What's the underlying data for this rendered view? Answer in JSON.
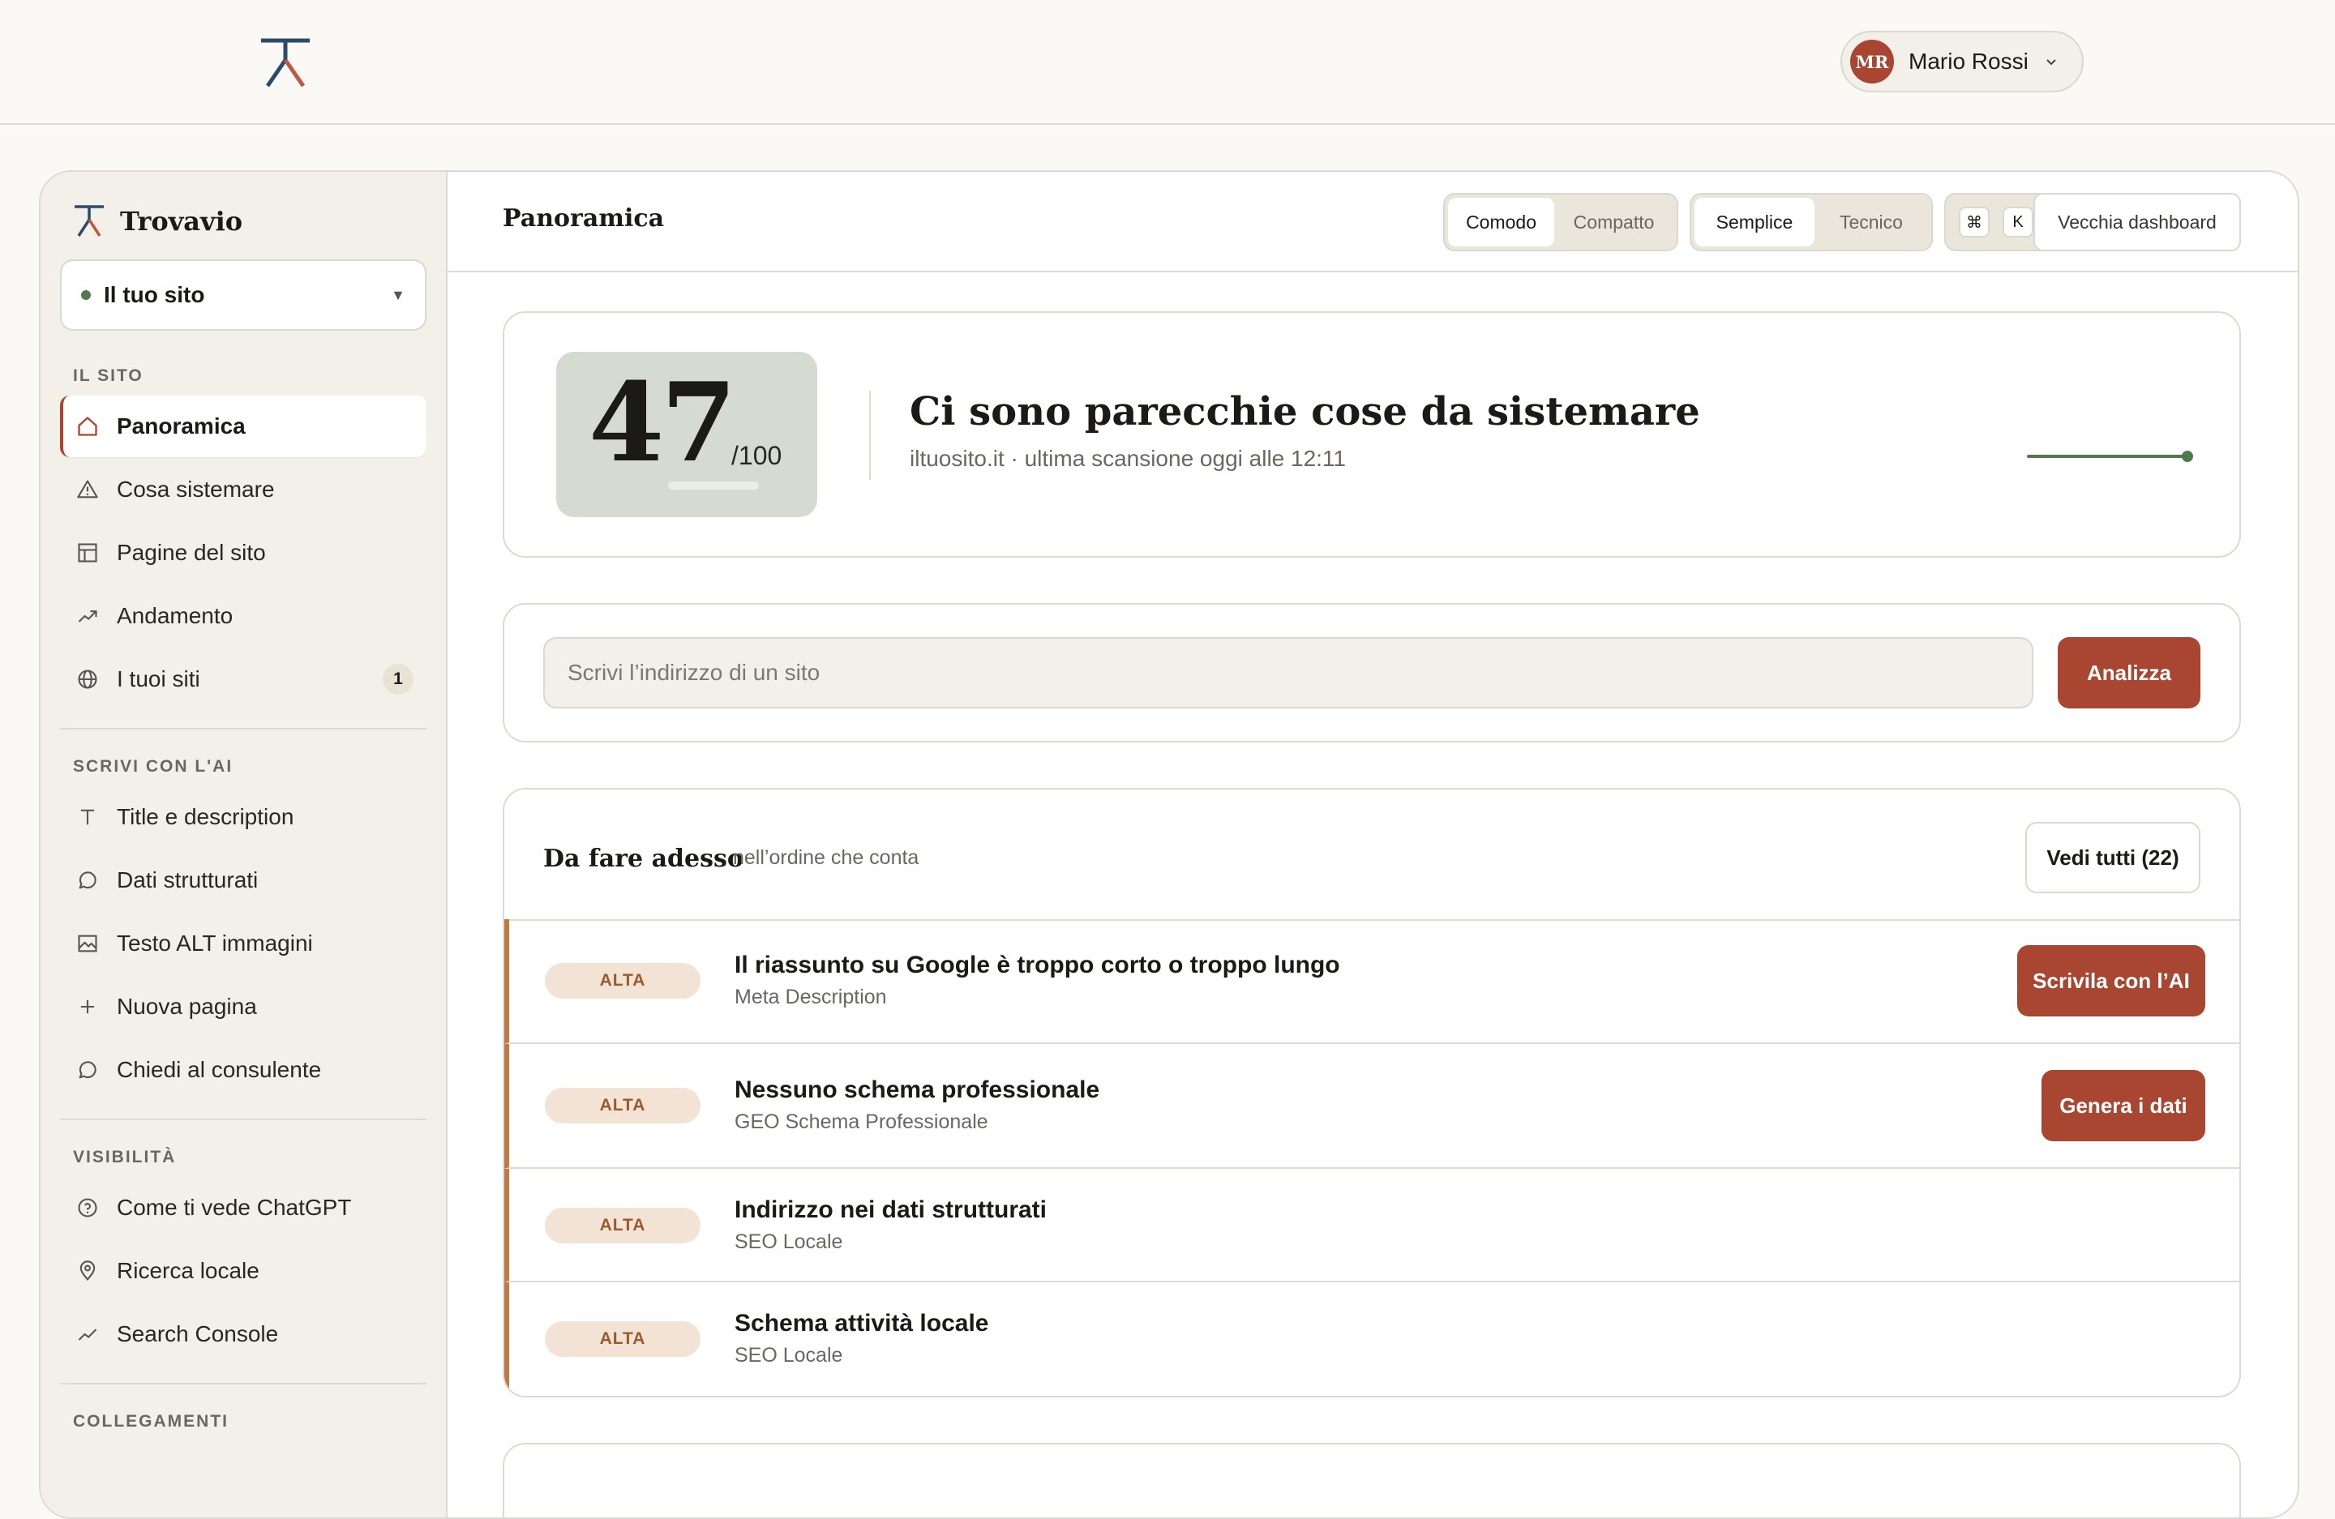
{
  "topbar": {
    "user": {
      "initials": "MR",
      "name": "Mario Rossi"
    }
  },
  "sidebar": {
    "brand": "Trovavio",
    "site_select": {
      "label": "Il tuo sito"
    },
    "sections": {
      "site": "IL SITO",
      "ai": "SCRIVI CON L'AI",
      "visibility": "VISIBILITÀ",
      "links": "COLLEGAMENTI"
    },
    "site_items": [
      {
        "label": "Panoramica",
        "icon": "home-icon",
        "active": true
      },
      {
        "label": "Cosa sistemare",
        "icon": "warning-icon"
      },
      {
        "label": "Pagine del sito",
        "icon": "layout-icon"
      },
      {
        "label": "Andamento",
        "icon": "trend-icon"
      },
      {
        "label": "I tuoi siti",
        "icon": "globe-icon",
        "badge": "1"
      }
    ],
    "ai_items": [
      {
        "label": "Title e description",
        "icon": "type-icon"
      },
      {
        "label": "Dati strutturati",
        "icon": "chat-icon"
      },
      {
        "label": "Testo ALT immagini",
        "icon": "image-icon"
      },
      {
        "label": "Nuova pagina",
        "icon": "plus-icon"
      },
      {
        "label": "Chiedi al consulente",
        "icon": "chat-icon"
      }
    ],
    "visibility_items": [
      {
        "label": "Come ti vede ChatGPT",
        "icon": "help-circle-icon"
      },
      {
        "label": "Ricerca locale",
        "icon": "map-pin-icon"
      },
      {
        "label": "Search Console",
        "icon": "trend-icon"
      }
    ]
  },
  "header": {
    "title": "Panoramica",
    "density": {
      "options": [
        "Comodo",
        "Compatto"
      ],
      "selected": "Comodo"
    },
    "mode": {
      "options": [
        "Semplice",
        "Tecnico"
      ],
      "selected": "Semplice"
    },
    "shortcut": [
      "⌘",
      "K"
    ],
    "old_dashboard": "Vecchia dashboard"
  },
  "score": {
    "value": "47",
    "max": "/100",
    "headline": "Ci sono parecchie cose da sistemare",
    "subline": "iltuosito.it · ultima scansione oggi alle 12:11"
  },
  "analyze": {
    "placeholder": "Scrivi l’indirizzo di un sito",
    "value": "",
    "button": "Analizza"
  },
  "todo": {
    "title": "Da fare adesso",
    "subtitle": "nell’ordine che conta",
    "see_all": "Vedi tutti (22)",
    "items": [
      {
        "priority": "ALTA",
        "title": "Il riassunto su Google è troppo corto o troppo lungo",
        "category": "Meta Description",
        "action": "Scrivila con l’AI"
      },
      {
        "priority": "ALTA",
        "title": "Nessuno schema professionale",
        "category": "GEO Schema Professionale",
        "action": "Genera i dati"
      },
      {
        "priority": "ALTA",
        "title": "Indirizzo nei dati strutturati",
        "category": "SEO Locale"
      },
      {
        "priority": "ALTA",
        "title": "Schema attività locale",
        "category": "SEO Locale"
      }
    ]
  },
  "colors": {
    "accent": "#a84632",
    "priority_border": "#c07a45",
    "score_bg": "#d6dbd1",
    "sidebar_bg": "#f3f0e9",
    "status_green": "#4f7a4c"
  }
}
